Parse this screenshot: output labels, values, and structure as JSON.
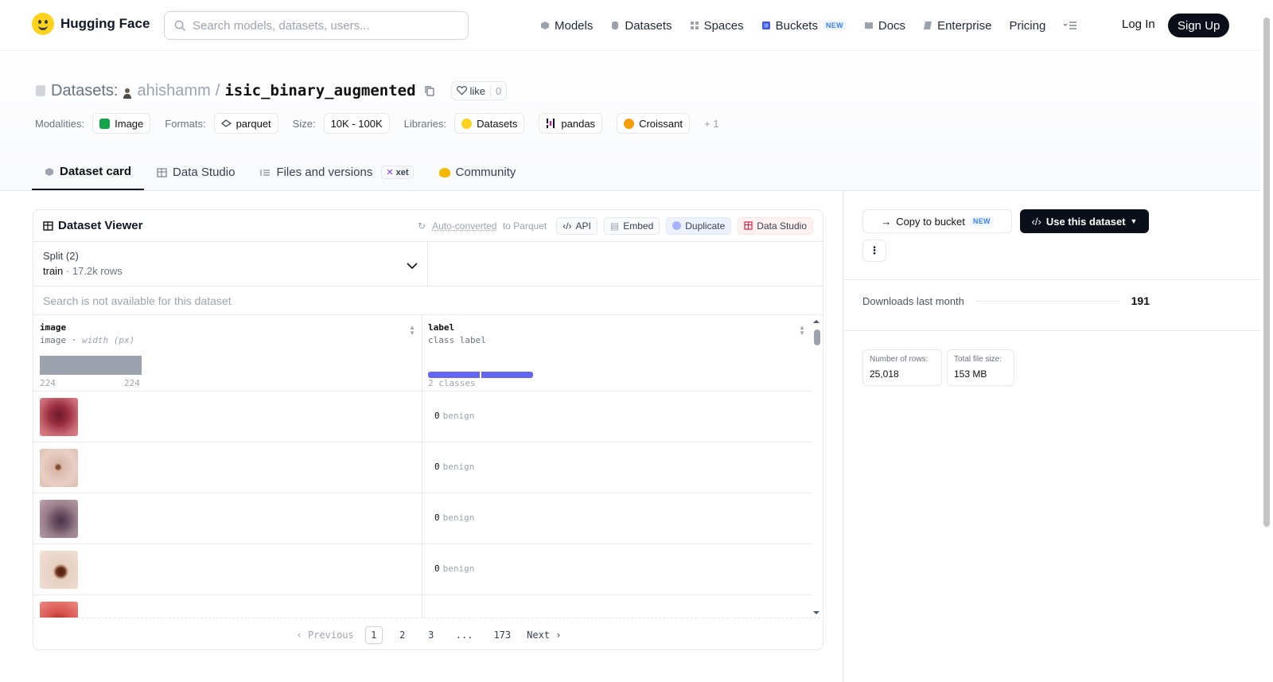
{
  "nav": {
    "brand": "Hugging Face",
    "search_placeholder": "Search models, datasets, users...",
    "links": [
      {
        "label": "Models",
        "icon": "cube-icon"
      },
      {
        "label": "Datasets",
        "icon": "database-icon"
      },
      {
        "label": "Spaces",
        "icon": "grid-icon"
      },
      {
        "label": "Buckets",
        "icon": "bucket-icon",
        "badge": "NEW"
      },
      {
        "label": "Docs",
        "icon": "book-icon"
      },
      {
        "label": "Enterprise",
        "icon": "enterprise-icon"
      },
      {
        "label": "Pricing"
      }
    ],
    "login": "Log In",
    "signup": "Sign Up"
  },
  "header": {
    "prefix": "Datasets:",
    "owner": "ahishamm",
    "separator": "/",
    "name": "isic_binary_augmented",
    "like_label": "like",
    "like_count": "0",
    "meta": {
      "modalities_label": "Modalities:",
      "modality": "Image",
      "formats_label": "Formats:",
      "format": "parquet",
      "size_label": "Size:",
      "size": "10K - 100K",
      "libraries_label": "Libraries:",
      "libraries": [
        "Datasets",
        "pandas",
        "Croissant"
      ],
      "more_libraries": "+ 1"
    }
  },
  "tabs": {
    "card": "Dataset card",
    "studio": "Data Studio",
    "files": "Files and versions",
    "xet": "xet",
    "community": "Community"
  },
  "viewer": {
    "title": "Dataset Viewer",
    "autoconv_link": "Auto-converted",
    "autoconv_suffix": "to Parquet",
    "api": "API",
    "embed": "Embed",
    "duplicate": "Duplicate",
    "data_studio": "Data Studio",
    "split_label": "Split (2)",
    "split_value": "train",
    "split_sep": "·",
    "split_rows": "17.2k rows",
    "search_note": "Search is not available for this dataset",
    "columns": [
      {
        "name": "image",
        "type": "image",
        "type_extra": "width (px)",
        "min": "224",
        "max": "224"
      },
      {
        "name": "label",
        "type": "class label",
        "classes": "2 classes"
      }
    ],
    "rows": [
      {
        "label_id": "0",
        "label_name": "benign",
        "thumb_color": "#b8505c"
      },
      {
        "label_id": "0",
        "label_name": "benign",
        "thumb_color": "#d9b8ac"
      },
      {
        "label_id": "0",
        "label_name": "benign",
        "thumb_color": "#8a6a78"
      },
      {
        "label_id": "0",
        "label_name": "benign",
        "thumb_color": "#e8d4c4"
      }
    ],
    "pager": {
      "prev": "Previous",
      "pages": [
        "1",
        "2",
        "3",
        "...",
        "173"
      ],
      "current": "1",
      "next": "Next"
    }
  },
  "side": {
    "copy_bucket": "Copy to bucket",
    "copy_badge": "NEW",
    "use_dataset": "Use this dataset",
    "downloads_label": "Downloads last month",
    "downloads": "191",
    "rows_label": "Number of rows:",
    "rows": "25,018",
    "size_label": "Total file size:",
    "size": "153 MB"
  }
}
